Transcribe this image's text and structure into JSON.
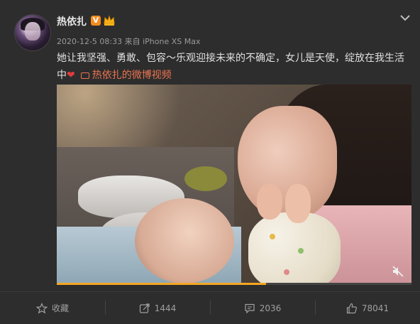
{
  "post": {
    "username": "热依扎",
    "verified_badge": "V",
    "timestamp": "2020-12-5 08:33",
    "source": "来自 iPhone XS Max",
    "content_line1": "她让我坚强、勇敢、包容～乐观迎接未来的不确定，女儿是天使，绽放在我生活",
    "content_line2_prefix": "中",
    "heart": "❤",
    "video_link_label": "热依扎的微博视频"
  },
  "video": {
    "progress": 0.59,
    "progress_color": "#f5a623",
    "mute_icon": "mute-icon"
  },
  "actions": {
    "favorite_label": "收藏",
    "repost_count": "1444",
    "comment_count": "2036",
    "like_count": "78041"
  },
  "colors": {
    "accent_link": "#eb7350",
    "verified": "#f78a1d",
    "background": "#2d2d2d"
  }
}
